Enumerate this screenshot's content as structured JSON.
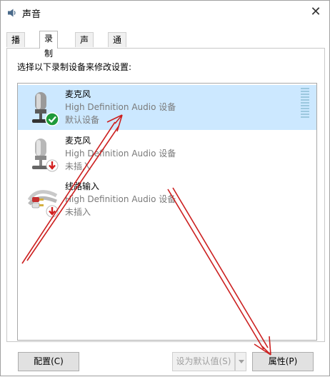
{
  "window": {
    "title": "声音"
  },
  "tabs": [
    {
      "label": "播放",
      "active": false
    },
    {
      "label": "录制",
      "active": true
    },
    {
      "label": "声音",
      "active": false
    },
    {
      "label": "通信",
      "active": false
    }
  ],
  "instruction": "选择以下录制设备来修改设置:",
  "devices": [
    {
      "name": "麦克风",
      "description": "High Definition Audio 设备",
      "status": "默认设备",
      "icon": "microphone-icon",
      "badge": "default-check-badge",
      "selected": true
    },
    {
      "name": "麦克风",
      "description": "High Definition Audio 设备",
      "status": "未插入",
      "icon": "microphone-icon",
      "badge": "unplugged-badge",
      "selected": false
    },
    {
      "name": "线路输入",
      "description": "High Definition Audio 设备",
      "status": "未插入",
      "icon": "line-in-cable-icon",
      "badge": "unplugged-badge",
      "selected": false
    }
  ],
  "buttons": {
    "configure": "配置(C)",
    "set_default": "设为默认值(S)",
    "properties": "属性(P)"
  },
  "colors": {
    "selection": "#cce8ff",
    "annotation_arrow": "#cc2020",
    "check_green": "#1e9a3a",
    "unplugged_red": "#d21f1f"
  }
}
